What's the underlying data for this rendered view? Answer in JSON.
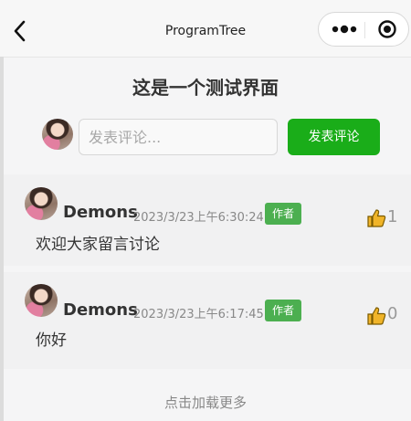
{
  "navbar": {
    "title": "ProgramTree",
    "back_icon": "chevron-left-icon",
    "menu_icon": "more-dots-icon",
    "close_icon": "target-circle-icon"
  },
  "page": {
    "title": "这是一个测试界面"
  },
  "composer": {
    "placeholder": "发表评论...",
    "value": "",
    "submit_label": "发表评论"
  },
  "comments": [
    {
      "username": "Demons",
      "time": "2023/3/23上午6:30:24",
      "badge": "作者",
      "likes": "1",
      "content": "欢迎大家留言讨论"
    },
    {
      "username": "Demons",
      "time": "2023/3/23上午6:17:45",
      "badge": "作者",
      "likes": "0",
      "content": "你好"
    }
  ],
  "footer": {
    "load_more": "点击加载更多"
  },
  "colors": {
    "accent": "#1aad19",
    "badge": "#4caf50",
    "like_icon": "#f0b429"
  }
}
